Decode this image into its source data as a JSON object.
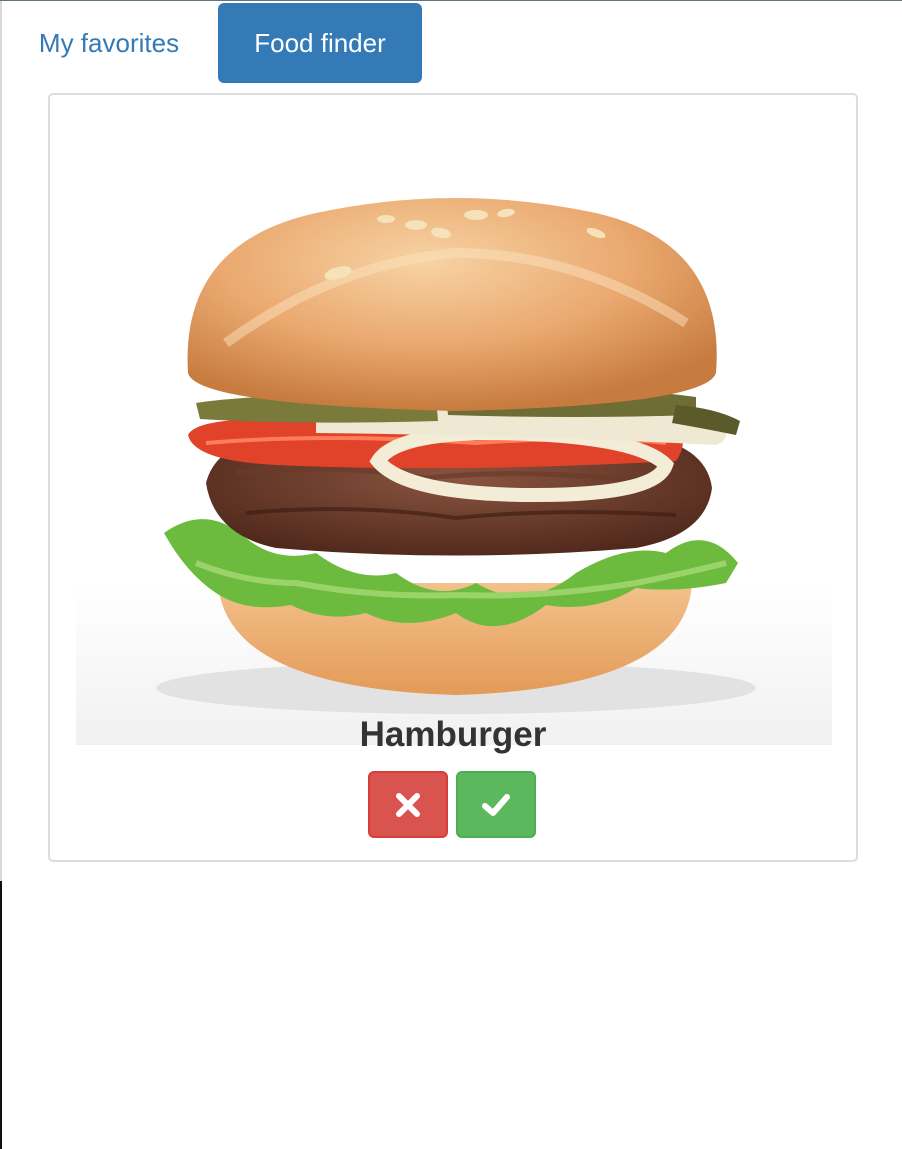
{
  "tabs": [
    {
      "label": "My favorites",
      "active": false
    },
    {
      "label": "Food finder",
      "active": true
    }
  ],
  "card": {
    "food_name": "Hamburger",
    "image_subject": "hamburger-photo",
    "reject_icon": "times-icon",
    "accept_icon": "check-icon"
  },
  "colors": {
    "primary": "#337ab7",
    "danger": "#d9534f",
    "success": "#5cb85c",
    "text": "#333333"
  }
}
